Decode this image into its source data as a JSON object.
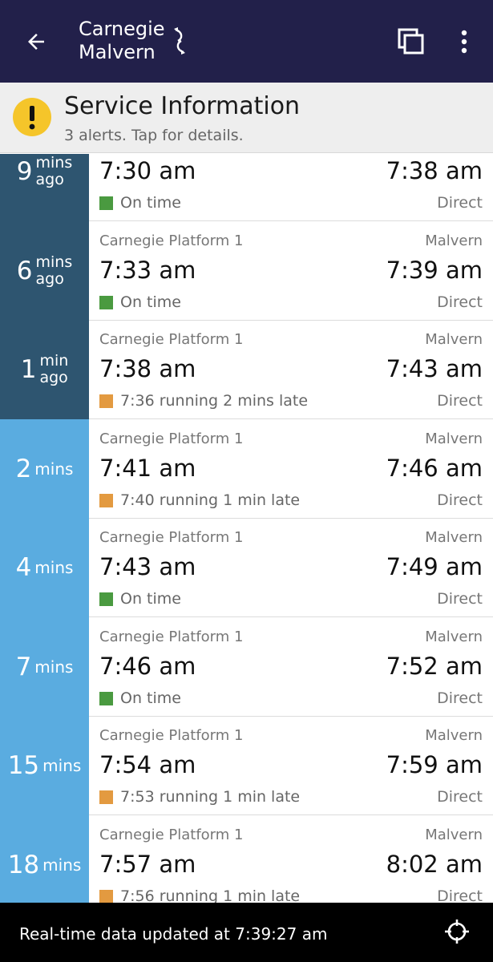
{
  "header": {
    "title_line1": "Carnegie",
    "title_line2": "Malvern",
    "bg_color": "#22204a",
    "icons": [
      "arrow-back-icon",
      "swap-direction-icon",
      "windows-icon",
      "more-vert-icon"
    ]
  },
  "alert": {
    "title": "Service Information",
    "subtitle": "3 alerts. Tap for details.",
    "icon": "warning-icon",
    "icon_color": "#f5c52a"
  },
  "colors": {
    "past": "#2e5570",
    "future": "#5aace0",
    "on_time": "#4a9a40",
    "late": "#e39a40"
  },
  "departures": [
    {
      "countdown": "9",
      "unit_line1": "mins",
      "unit_line2": "ago",
      "past": true,
      "platform": "",
      "destination": "",
      "depart": "7:30 am",
      "arrive": "7:38 am",
      "status": "On time",
      "status_type": "on_time",
      "route": "Direct"
    },
    {
      "countdown": "6",
      "unit_line1": "mins",
      "unit_line2": "ago",
      "past": true,
      "platform": "Carnegie Platform 1",
      "destination": "Malvern",
      "depart": "7:33 am",
      "arrive": "7:39 am",
      "status": "On time",
      "status_type": "on_time",
      "route": "Direct"
    },
    {
      "countdown": "1",
      "unit_line1": "min",
      "unit_line2": "ago",
      "past": true,
      "platform": "Carnegie Platform 1",
      "destination": "Malvern",
      "depart": "7:38 am",
      "arrive": "7:43 am",
      "status": "7:36 running 2 mins late",
      "status_type": "late",
      "route": "Direct"
    },
    {
      "countdown": "2",
      "unit_line1": "mins",
      "unit_line2": "",
      "past": false,
      "platform": "Carnegie Platform 1",
      "destination": "Malvern",
      "depart": "7:41 am",
      "arrive": "7:46 am",
      "status": "7:40 running 1 min late",
      "status_type": "late",
      "route": "Direct"
    },
    {
      "countdown": "4",
      "unit_line1": "mins",
      "unit_line2": "",
      "past": false,
      "platform": "Carnegie Platform 1",
      "destination": "Malvern",
      "depart": "7:43 am",
      "arrive": "7:49 am",
      "status": "On time",
      "status_type": "on_time",
      "route": "Direct"
    },
    {
      "countdown": "7",
      "unit_line1": "mins",
      "unit_line2": "",
      "past": false,
      "platform": "Carnegie Platform 1",
      "destination": "Malvern",
      "depart": "7:46 am",
      "arrive": "7:52 am",
      "status": "On time",
      "status_type": "on_time",
      "route": "Direct"
    },
    {
      "countdown": "15",
      "unit_line1": "mins",
      "unit_line2": "",
      "past": false,
      "platform": "Carnegie Platform 1",
      "destination": "Malvern",
      "depart": "7:54 am",
      "arrive": "7:59 am",
      "status": "7:53 running 1 min late",
      "status_type": "late",
      "route": "Direct"
    },
    {
      "countdown": "18",
      "unit_line1": "mins",
      "unit_line2": "",
      "past": false,
      "platform": "Carnegie Platform 1",
      "destination": "Malvern",
      "depart": "7:57 am",
      "arrive": "8:02 am",
      "status": "7:56 running 1 min late",
      "status_type": "late",
      "route": "Direct"
    }
  ],
  "footer": {
    "text": "Real-time data updated at 7:39:27 am",
    "icon": "locate-icon"
  }
}
